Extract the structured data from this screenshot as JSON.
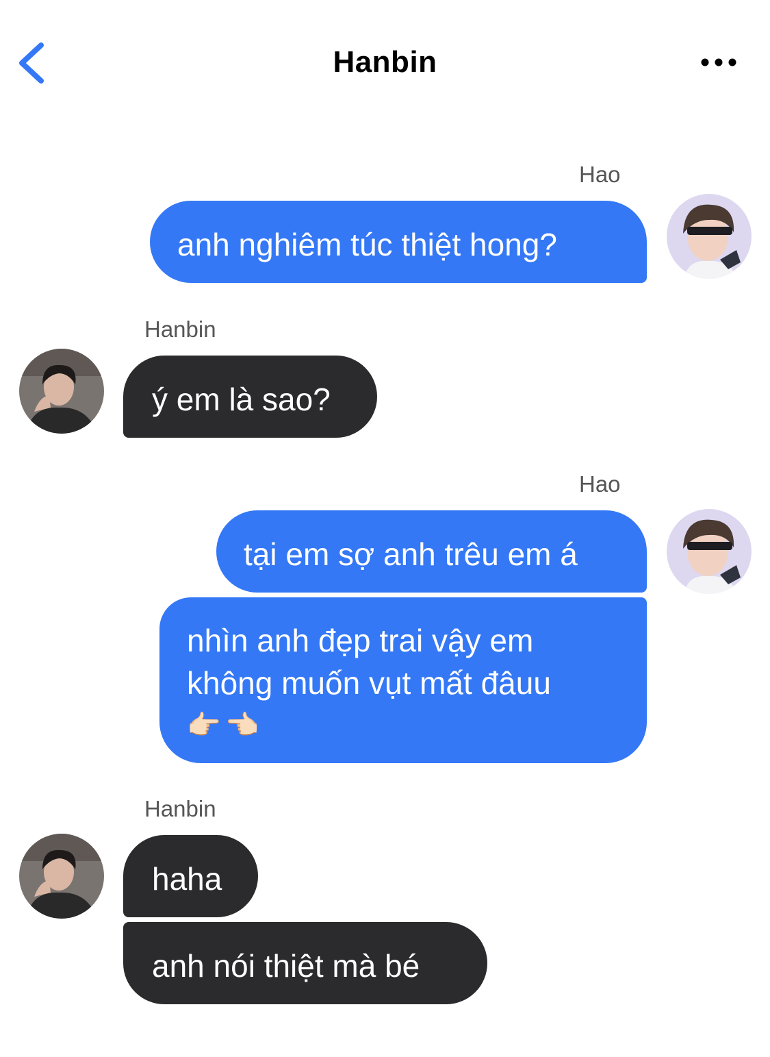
{
  "header": {
    "title": "Hanbin",
    "back_icon": "chevron-left-icon",
    "more_icon": "more-horizontal-icon",
    "accent_color": "#3478f6"
  },
  "participants": {
    "me": "Hao",
    "other": "Hanbin"
  },
  "messages": [
    {
      "from": "Hao",
      "text": "anh nghiêm túc thiệt hong?"
    },
    {
      "from": "Hanbin",
      "text": "ý em là sao?"
    },
    {
      "from": "Hao",
      "text": "tại em sợ anh trêu em á"
    },
    {
      "from": "Hao",
      "lines": [
        "nhìn anh đẹp trai vậy em",
        "không muốn vụt mất đâuu",
        "👉🏻👈🏻"
      ]
    },
    {
      "from": "Hanbin",
      "text": "haha"
    },
    {
      "from": "Hanbin",
      "text": "anh nói thiệt mà bé"
    }
  ],
  "colors": {
    "outgoing_bubble": "#3478f6",
    "incoming_bubble": "#2b2b2d",
    "sender_label": "#555555"
  }
}
